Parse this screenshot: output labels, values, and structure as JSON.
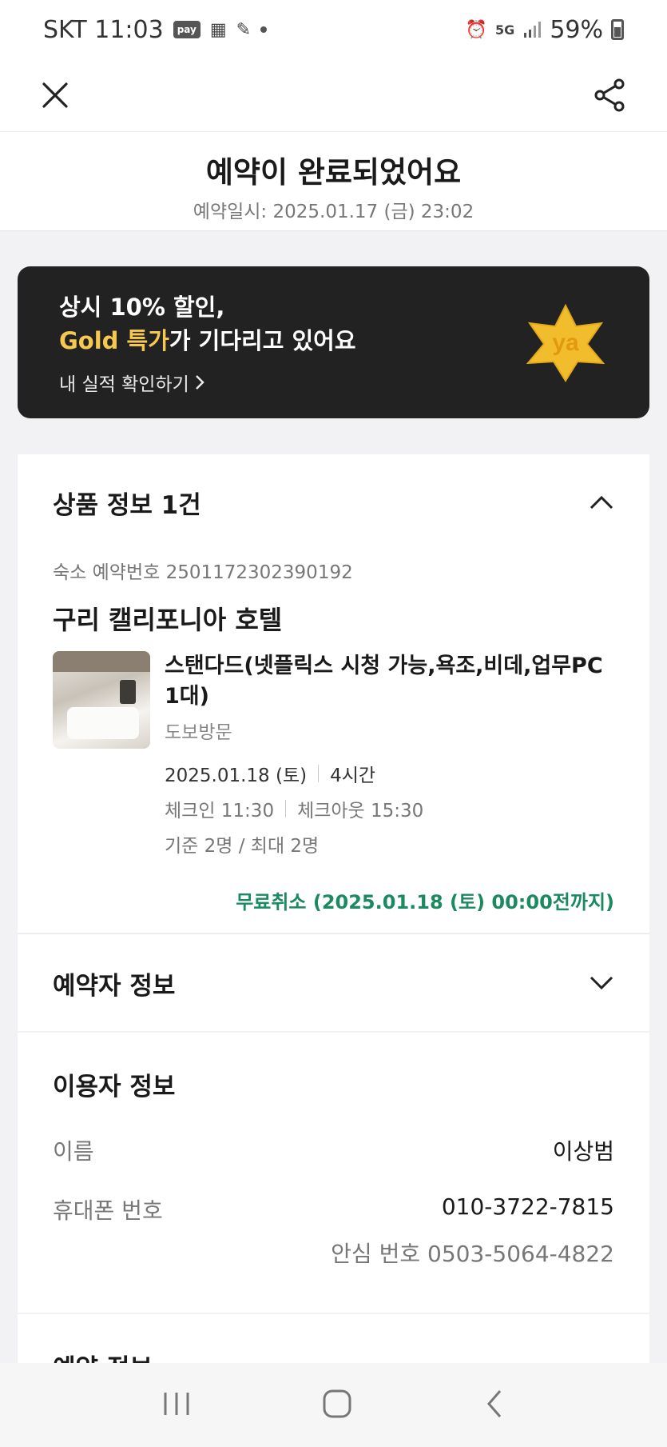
{
  "status_bar": {
    "carrier_time": "SKT 11:03",
    "pay_badge": "pay",
    "network": "5G",
    "battery": "59%"
  },
  "app_bar": {
    "close_icon": "close-icon",
    "share_icon": "share-icon"
  },
  "header": {
    "title": "예약이 완료되었어요",
    "subtitle": "예약일시: 2025.01.17 (금) 23:02"
  },
  "banner": {
    "line1": "상시 10% 할인,",
    "line2_gold": "Gold 특가",
    "line2_rest": "가 기다리고 있어요",
    "link": "내 실적 확인하기",
    "logo_text": "ya"
  },
  "product": {
    "section_title": "상품 정보 1건",
    "reservation_no": "숙소 예약번호 2501172302390192",
    "hotel_name": "구리 캘리포니아 호텔",
    "room_name": "스탠다드(넷플릭스 시청 가능,욕조,비데,업무PC 1대)",
    "visit_type": "도보방문",
    "date": "2025.01.18 (토)",
    "duration": "4시간",
    "checkin": "체크인 11:30",
    "checkout": "체크아웃 15:30",
    "capacity": "기준 2명 / 최대 2명",
    "free_cancel": "무료취소 (2025.01.18 (토) 00:00전까지)"
  },
  "booker": {
    "section_title": "예약자 정보"
  },
  "user": {
    "section_title": "이용자 정보",
    "name_label": "이름",
    "name_value": "이상범",
    "phone_label": "휴대폰 번호",
    "phone_value": "010-3722-7815",
    "safe_number": "안심 번호 0503-5064-4822"
  },
  "next_section": {
    "section_title": "예약 정보"
  },
  "colors": {
    "banner_bg": "#222222",
    "gold": "#f6c84f",
    "free_cancel": "#1b8a61"
  }
}
